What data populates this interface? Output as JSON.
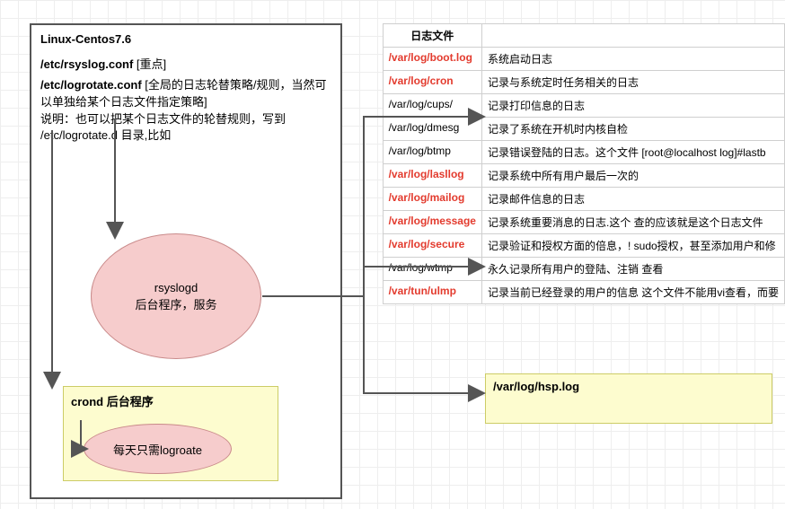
{
  "leftbox": {
    "title": "Linux-Centos7.6",
    "cfg1_a": "/etc/rsyslog.conf ",
    "cfg1_b": "[重点]",
    "cfg2_a": "/etc/logrotate.conf ",
    "cfg2_b": "[全局的日志轮替策略/规则，当然可以单独给某个日志文件指定策略]",
    "note": "说明：也可以把某个日志文件的轮替规则，写到 /etc/logrotate.d 目录,比如"
  },
  "rsyslogd": {
    "line1": "rsyslogd",
    "line2": "后台程序，服务"
  },
  "crond": {
    "title": "crond 后台程序",
    "oval": "每天只需logroate"
  },
  "table": {
    "h1": "日志文件",
    "rows": [
      {
        "path": "/var/log/boot.log",
        "red": true,
        "desc": "系统启动日志"
      },
      {
        "path": "/var/log/cron",
        "red": true,
        "desc": "记录与系统定时任务相关的日志"
      },
      {
        "path": "/var/log/cups/",
        "red": false,
        "desc": "记录打印信息的日志"
      },
      {
        "path": "/var/log/dmesg",
        "red": false,
        "desc": "记录了系统在开机时内核自检"
      },
      {
        "path": "/var/log/btmp",
        "red": false,
        "desc": "记录错误登陆的日志。这个文件\n[root@localhost log]#lastb"
      },
      {
        "path": "/var/log/lasllog",
        "red": true,
        "desc": "记录系统中所有用户最后一次的"
      },
      {
        "path": "/var/log/mailog",
        "red": true,
        "desc": "记录邮件信息的日志"
      },
      {
        "path": "/var/log/message",
        "red": true,
        "desc": "记录系统重要消息的日志.这个\n查的应该就是这个日志文件"
      },
      {
        "path": "/var/log/secure",
        "red": true,
        "desc": "记录验证和授权方面的倍息，!\nsudo授权，甚至添加用户和修"
      },
      {
        "path": "/var/log/wtmp",
        "red": false,
        "desc": "永久记录所有用户的登陆、注销\n查看"
      },
      {
        "path": "/var/tun/ulmp",
        "red": true,
        "desc": "记录当前已经登录的用户的信息\n这个文件不能用vi查看，而要"
      }
    ]
  },
  "hsp": {
    "path": "/var/log/hsp.log"
  }
}
